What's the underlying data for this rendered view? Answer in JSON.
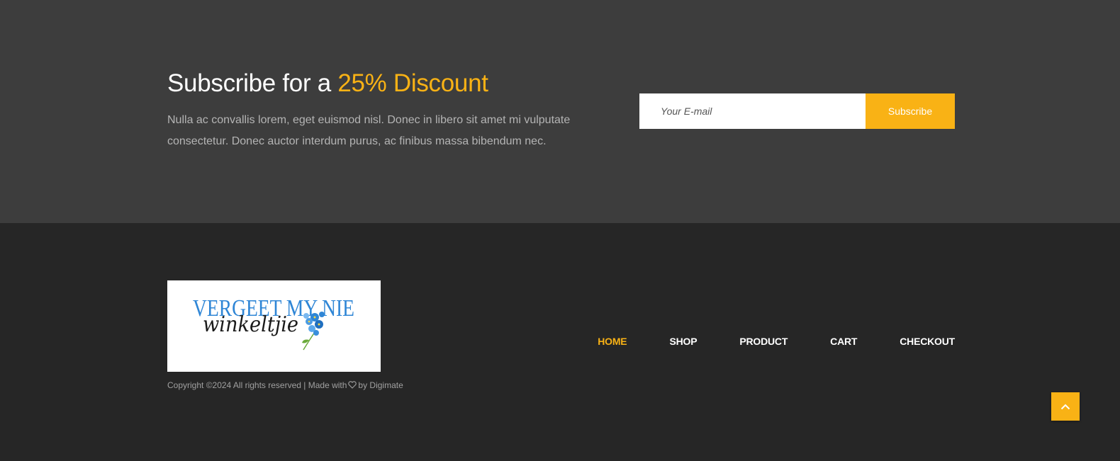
{
  "subscribe": {
    "title_prefix": "Subscribe for a ",
    "title_accent": "25% Discount",
    "description": "Nulla ac convallis lorem, eget euismod nisl. Donec in libero sit amet mi vulputate consectetur. Donec auctor interdum purus, ac finibus massa bibendum nec.",
    "email_placeholder": "Your E-mail",
    "email_value": "",
    "button_label": "Subscribe"
  },
  "footer": {
    "logo": {
      "line1": "VERGEET MY NIE",
      "line2": "winkeltjie"
    },
    "copyright_before": "Copyright ©2024 All rights reserved | Made with",
    "copyright_after": "by Digimate",
    "nav": [
      {
        "label": "HOME",
        "active": true
      },
      {
        "label": "SHOP",
        "active": false
      },
      {
        "label": "PRODUCT",
        "active": false
      },
      {
        "label": "CART",
        "active": false
      },
      {
        "label": "CHECKOUT",
        "active": false
      }
    ]
  },
  "colors": {
    "accent": "#f9b215",
    "subscribe_bg": "#3d3d3d",
    "footer_bg": "#262626",
    "logo_blue": "#2f86d6"
  },
  "icons": {
    "heart": "heart-icon",
    "scroll_top": "chevron-up-icon"
  }
}
